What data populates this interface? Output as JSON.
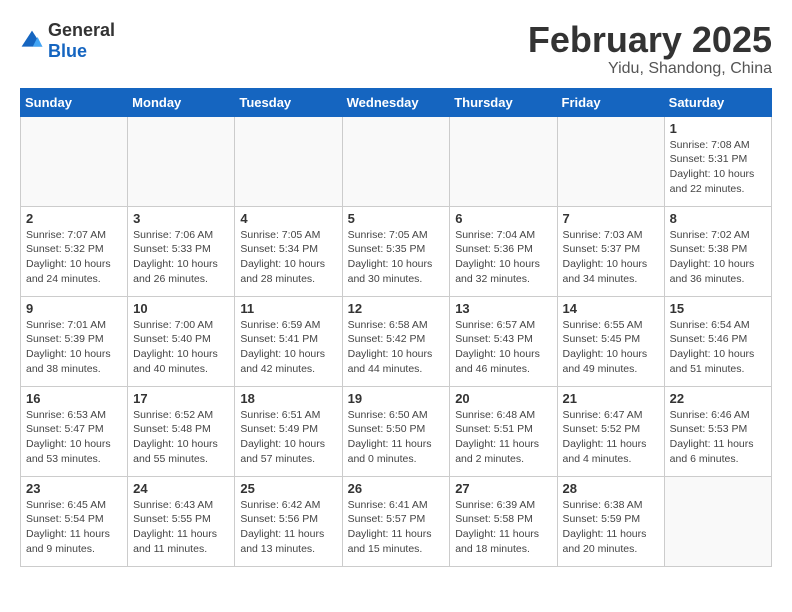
{
  "header": {
    "logo_general": "General",
    "logo_blue": "Blue",
    "month_year": "February 2025",
    "location": "Yidu, Shandong, China"
  },
  "weekdays": [
    "Sunday",
    "Monday",
    "Tuesday",
    "Wednesday",
    "Thursday",
    "Friday",
    "Saturday"
  ],
  "weeks": [
    [
      {
        "day": "",
        "info": ""
      },
      {
        "day": "",
        "info": ""
      },
      {
        "day": "",
        "info": ""
      },
      {
        "day": "",
        "info": ""
      },
      {
        "day": "",
        "info": ""
      },
      {
        "day": "",
        "info": ""
      },
      {
        "day": "1",
        "info": "Sunrise: 7:08 AM\nSunset: 5:31 PM\nDaylight: 10 hours\nand 22 minutes."
      }
    ],
    [
      {
        "day": "2",
        "info": "Sunrise: 7:07 AM\nSunset: 5:32 PM\nDaylight: 10 hours\nand 24 minutes."
      },
      {
        "day": "3",
        "info": "Sunrise: 7:06 AM\nSunset: 5:33 PM\nDaylight: 10 hours\nand 26 minutes."
      },
      {
        "day": "4",
        "info": "Sunrise: 7:05 AM\nSunset: 5:34 PM\nDaylight: 10 hours\nand 28 minutes."
      },
      {
        "day": "5",
        "info": "Sunrise: 7:05 AM\nSunset: 5:35 PM\nDaylight: 10 hours\nand 30 minutes."
      },
      {
        "day": "6",
        "info": "Sunrise: 7:04 AM\nSunset: 5:36 PM\nDaylight: 10 hours\nand 32 minutes."
      },
      {
        "day": "7",
        "info": "Sunrise: 7:03 AM\nSunset: 5:37 PM\nDaylight: 10 hours\nand 34 minutes."
      },
      {
        "day": "8",
        "info": "Sunrise: 7:02 AM\nSunset: 5:38 PM\nDaylight: 10 hours\nand 36 minutes."
      }
    ],
    [
      {
        "day": "9",
        "info": "Sunrise: 7:01 AM\nSunset: 5:39 PM\nDaylight: 10 hours\nand 38 minutes."
      },
      {
        "day": "10",
        "info": "Sunrise: 7:00 AM\nSunset: 5:40 PM\nDaylight: 10 hours\nand 40 minutes."
      },
      {
        "day": "11",
        "info": "Sunrise: 6:59 AM\nSunset: 5:41 PM\nDaylight: 10 hours\nand 42 minutes."
      },
      {
        "day": "12",
        "info": "Sunrise: 6:58 AM\nSunset: 5:42 PM\nDaylight: 10 hours\nand 44 minutes."
      },
      {
        "day": "13",
        "info": "Sunrise: 6:57 AM\nSunset: 5:43 PM\nDaylight: 10 hours\nand 46 minutes."
      },
      {
        "day": "14",
        "info": "Sunrise: 6:55 AM\nSunset: 5:45 PM\nDaylight: 10 hours\nand 49 minutes."
      },
      {
        "day": "15",
        "info": "Sunrise: 6:54 AM\nSunset: 5:46 PM\nDaylight: 10 hours\nand 51 minutes."
      }
    ],
    [
      {
        "day": "16",
        "info": "Sunrise: 6:53 AM\nSunset: 5:47 PM\nDaylight: 10 hours\nand 53 minutes."
      },
      {
        "day": "17",
        "info": "Sunrise: 6:52 AM\nSunset: 5:48 PM\nDaylight: 10 hours\nand 55 minutes."
      },
      {
        "day": "18",
        "info": "Sunrise: 6:51 AM\nSunset: 5:49 PM\nDaylight: 10 hours\nand 57 minutes."
      },
      {
        "day": "19",
        "info": "Sunrise: 6:50 AM\nSunset: 5:50 PM\nDaylight: 11 hours\nand 0 minutes."
      },
      {
        "day": "20",
        "info": "Sunrise: 6:48 AM\nSunset: 5:51 PM\nDaylight: 11 hours\nand 2 minutes."
      },
      {
        "day": "21",
        "info": "Sunrise: 6:47 AM\nSunset: 5:52 PM\nDaylight: 11 hours\nand 4 minutes."
      },
      {
        "day": "22",
        "info": "Sunrise: 6:46 AM\nSunset: 5:53 PM\nDaylight: 11 hours\nand 6 minutes."
      }
    ],
    [
      {
        "day": "23",
        "info": "Sunrise: 6:45 AM\nSunset: 5:54 PM\nDaylight: 11 hours\nand 9 minutes."
      },
      {
        "day": "24",
        "info": "Sunrise: 6:43 AM\nSunset: 5:55 PM\nDaylight: 11 hours\nand 11 minutes."
      },
      {
        "day": "25",
        "info": "Sunrise: 6:42 AM\nSunset: 5:56 PM\nDaylight: 11 hours\nand 13 minutes."
      },
      {
        "day": "26",
        "info": "Sunrise: 6:41 AM\nSunset: 5:57 PM\nDaylight: 11 hours\nand 15 minutes."
      },
      {
        "day": "27",
        "info": "Sunrise: 6:39 AM\nSunset: 5:58 PM\nDaylight: 11 hours\nand 18 minutes."
      },
      {
        "day": "28",
        "info": "Sunrise: 6:38 AM\nSunset: 5:59 PM\nDaylight: 11 hours\nand 20 minutes."
      },
      {
        "day": "",
        "info": ""
      }
    ]
  ]
}
